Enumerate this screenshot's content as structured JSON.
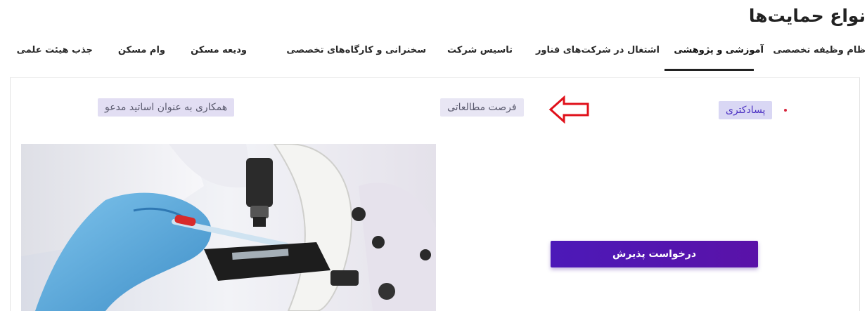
{
  "header": {
    "title": "نواع حمایت‌ها"
  },
  "tabs": [
    {
      "label": "ظام وظیفه تخصصی"
    },
    {
      "label": "آموزشی و پژوهشی"
    },
    {
      "label": "اشتغال در شرکت‌های فناور"
    },
    {
      "label": "تاسیس شرکت"
    },
    {
      "label": "سخنرانی و کارگاه‌های تخصصی"
    },
    {
      "label": "ودیعه مسکن"
    },
    {
      "label": "وام مسکن"
    },
    {
      "label": "جذب هیئت علمی"
    }
  ],
  "active_tab": "آموزشی و پژوهشی",
  "chips": {
    "postdoc": "پسادکتری",
    "sabbatical": "فرصت مطالعاتی",
    "visiting": "همکاری به عنوان اساتید مدعو"
  },
  "apply_button": {
    "label": "درخواست پذیرش"
  },
  "colors": {
    "accent": "#4c19b8",
    "chip_bg": "#e2def3",
    "arrow": "#e0101a"
  },
  "image": {
    "subject": "gloved hand with pipette at a microscope"
  }
}
